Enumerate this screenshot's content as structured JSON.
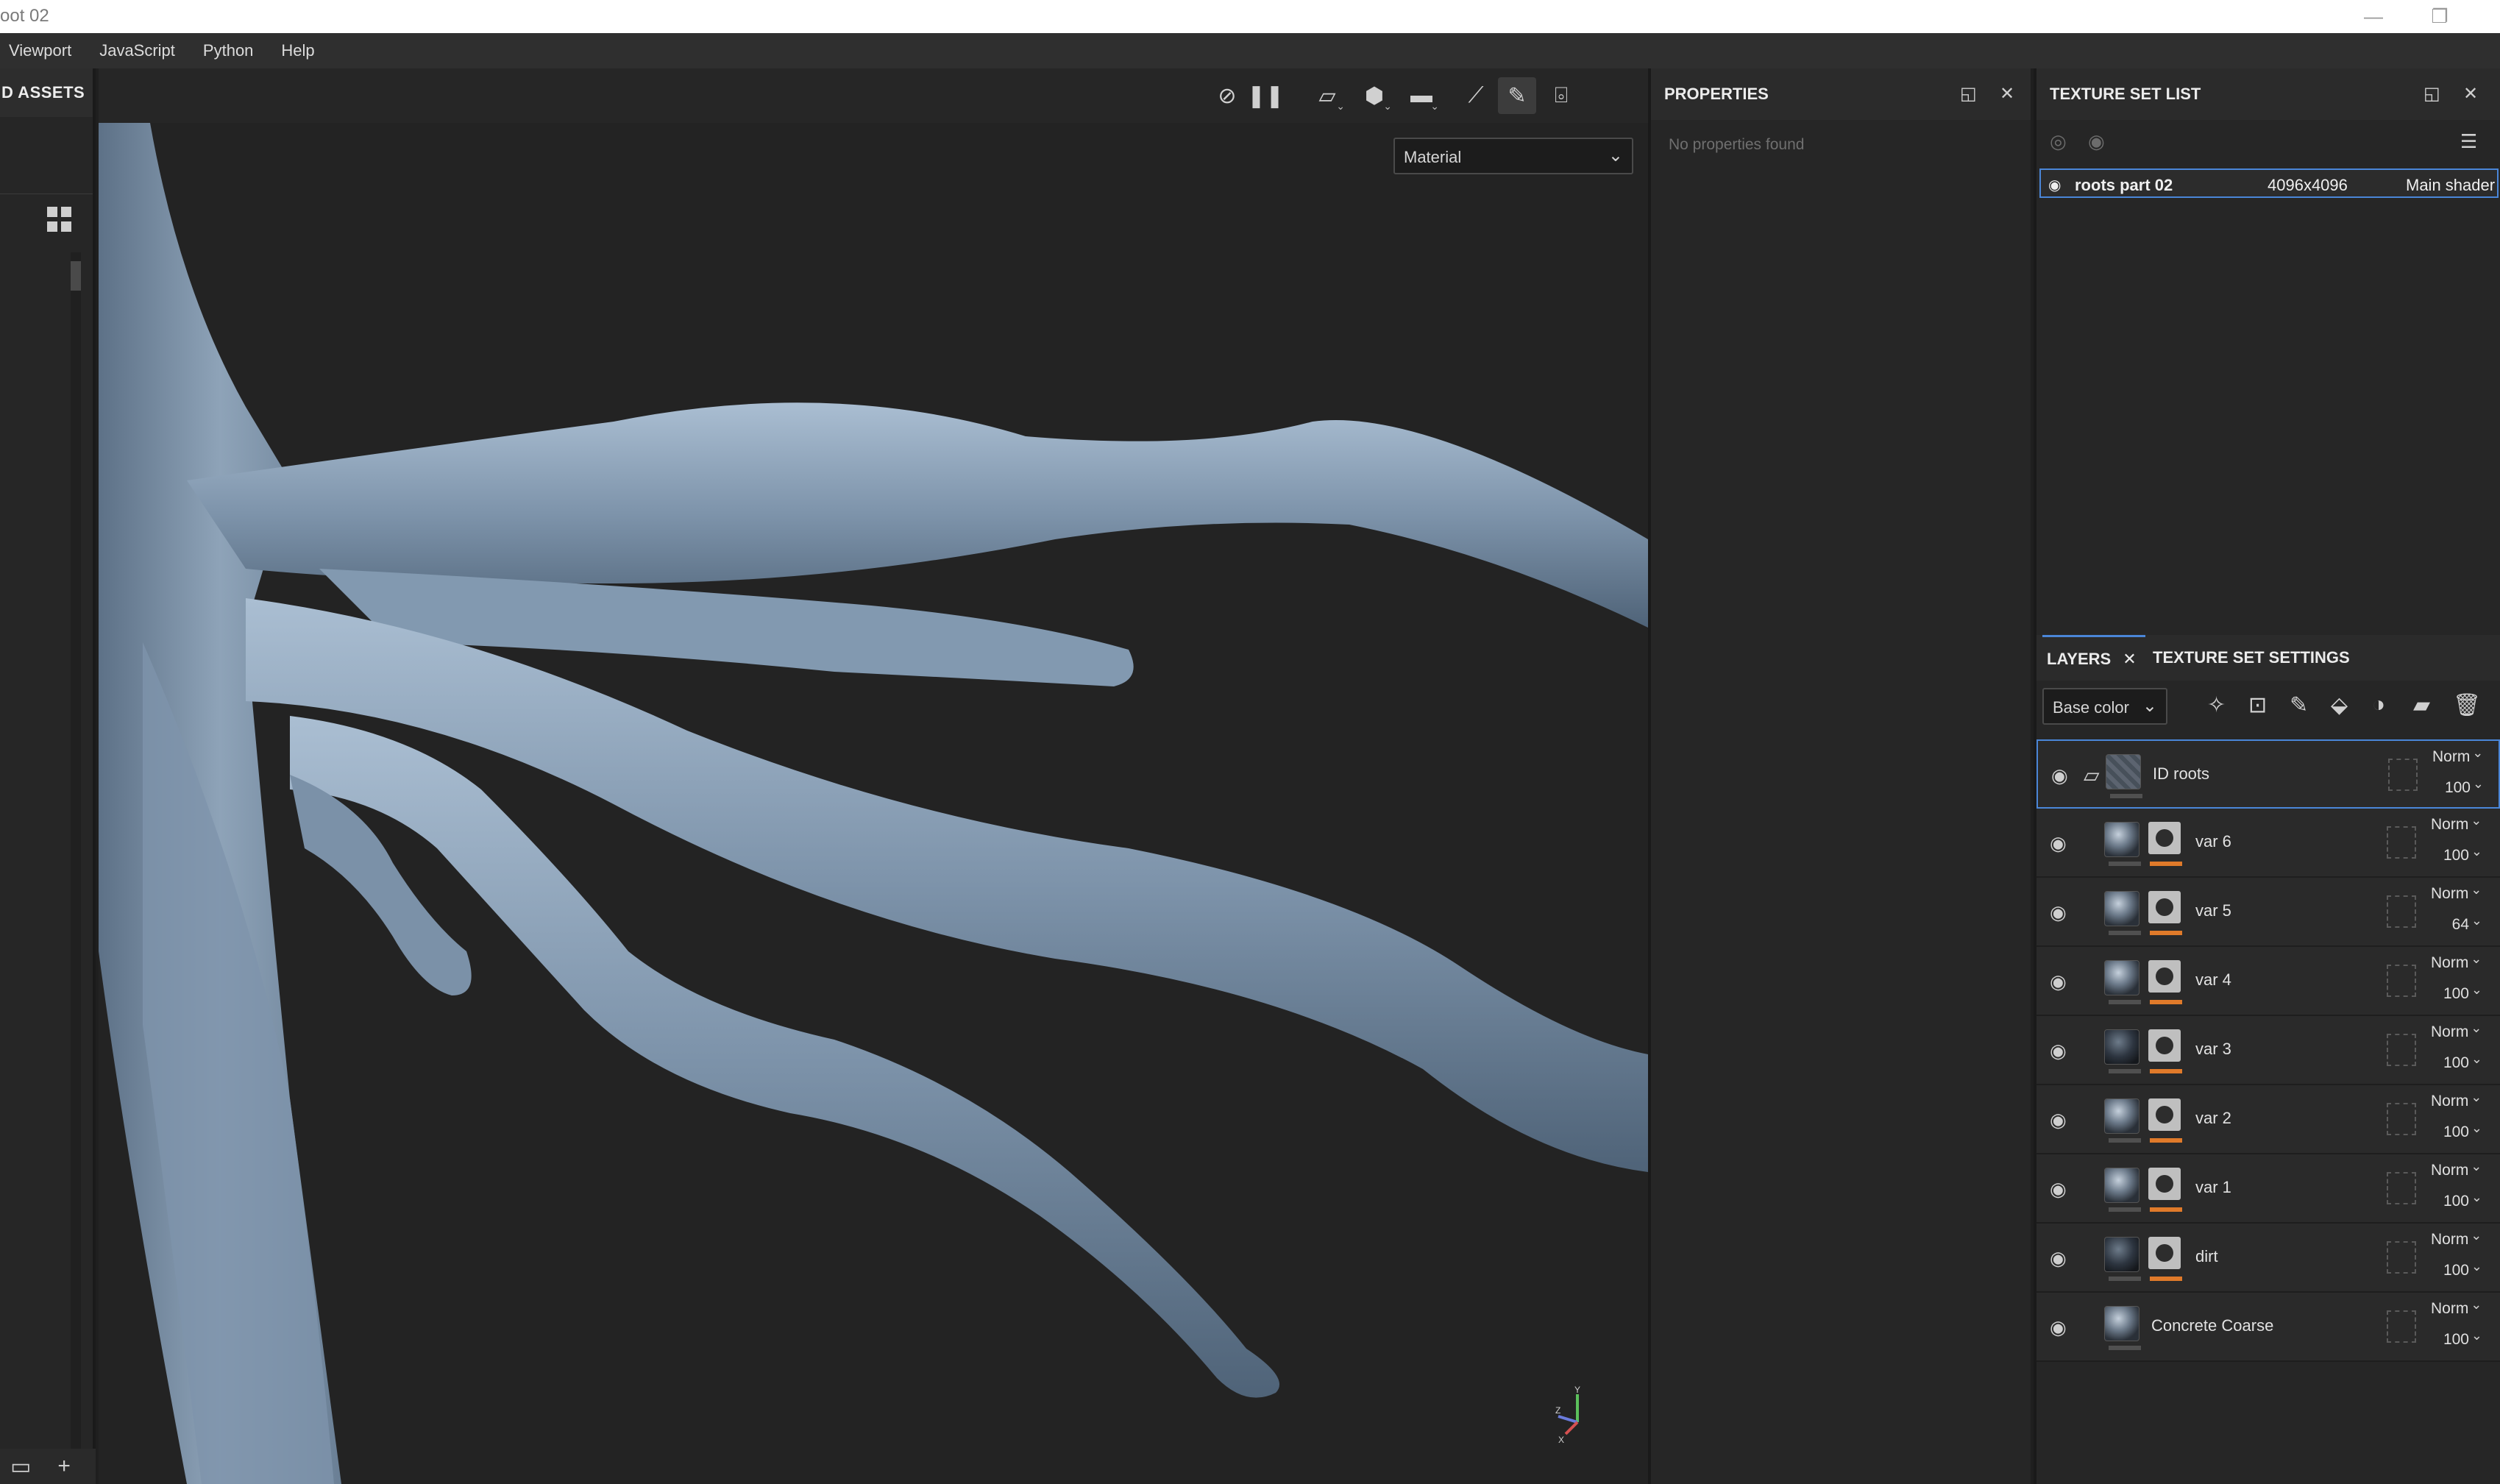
{
  "window": {
    "title": "oot 02",
    "minimize": "—",
    "restore": "❐"
  },
  "menu": [
    "Viewport",
    "JavaScript",
    "Python",
    "Help"
  ],
  "left_panel": {
    "title": "D ASSETS"
  },
  "viewport": {
    "channel_dropdown": "Material",
    "axis_labels": {
      "y": "Y",
      "z": "Z",
      "x": "X"
    }
  },
  "properties": {
    "title": "PROPERTIES",
    "empty_text": "No properties found"
  },
  "texture_set_list": {
    "title": "TEXTURE SET LIST",
    "row": {
      "name": "roots part 02",
      "resolution": "4096x4096",
      "shader": "Main shader"
    }
  },
  "layers_panel": {
    "tabs": [
      "LAYERS",
      "TEXTURE SET SETTINGS"
    ],
    "channel": "Base color",
    "layers": [
      {
        "name": "ID roots",
        "blend": "Norm",
        "opacity": "100",
        "type": "folder"
      },
      {
        "name": "var 6",
        "blend": "Norm",
        "opacity": "100",
        "type": "fill"
      },
      {
        "name": "var 5",
        "blend": "Norm",
        "opacity": "64",
        "type": "fill"
      },
      {
        "name": "var 4",
        "blend": "Norm",
        "opacity": "100",
        "type": "fill"
      },
      {
        "name": "var 3",
        "blend": "Norm",
        "opacity": "100",
        "type": "fill"
      },
      {
        "name": "var 2",
        "blend": "Norm",
        "opacity": "100",
        "type": "fill"
      },
      {
        "name": "var 1",
        "blend": "Norm",
        "opacity": "100",
        "type": "fill"
      },
      {
        "name": "dirt",
        "blend": "Norm",
        "opacity": "100",
        "type": "fill-dark"
      },
      {
        "name": "Concrete Coarse",
        "blend": "Norm",
        "opacity": "100",
        "type": "material"
      }
    ]
  },
  "colors": {
    "accent_blue": "#4a86d8",
    "mask_orange": "#e07a2a",
    "root_color": "#8fa3b8"
  }
}
